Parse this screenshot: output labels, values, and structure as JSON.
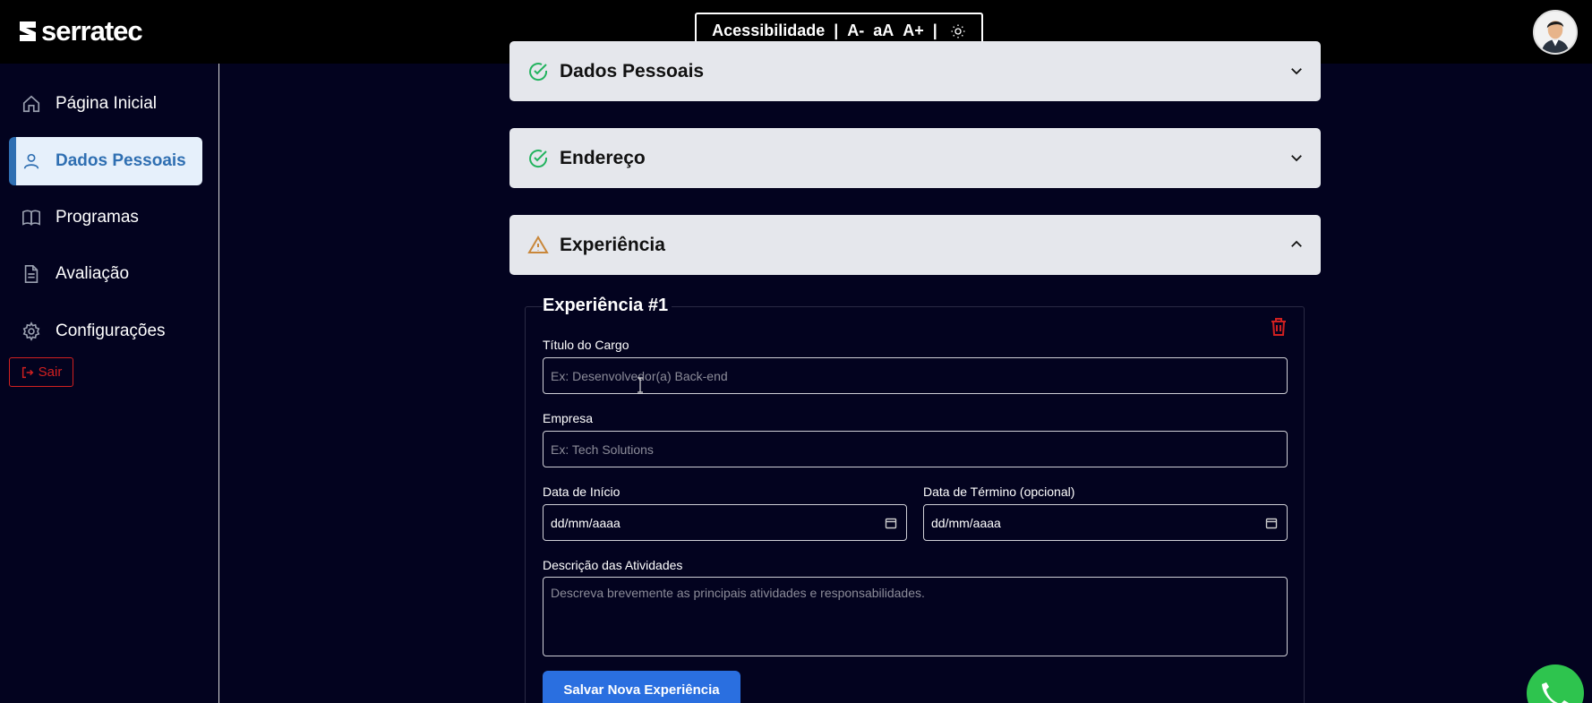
{
  "header": {
    "logo_text": "serratec",
    "accessibility": {
      "label": "Acessibilidade",
      "separator": "|",
      "decrease": "A-",
      "reset": "aA",
      "increase": "A+"
    }
  },
  "sidebar": {
    "items": [
      {
        "label": "Página Inicial",
        "icon": "home-icon"
      },
      {
        "label": "Dados Pessoais",
        "icon": "user-icon",
        "active": true
      },
      {
        "label": "Programas",
        "icon": "book-icon"
      },
      {
        "label": "Avaliação",
        "icon": "document-icon"
      },
      {
        "label": "Configurações",
        "icon": "gear-icon"
      }
    ],
    "logout_label": "Sair"
  },
  "sections": [
    {
      "title": "Dados Pessoais",
      "status": "complete"
    },
    {
      "title": "Endereço",
      "status": "complete"
    },
    {
      "title": "Experiência",
      "status": "warning",
      "expanded": true
    }
  ],
  "experience": {
    "card_title": "Experiência #1",
    "job_title": {
      "label": "Título do Cargo",
      "placeholder": "Ex: Desenvolvedor(a) Back-end"
    },
    "company": {
      "label": "Empresa",
      "placeholder": "Ex: Tech Solutions"
    },
    "start_date": {
      "label": "Data de Início",
      "value": "dd/mm/aaaa"
    },
    "end_date": {
      "label": "Data de Término (opcional)",
      "value": "dd/mm/aaaa"
    },
    "description": {
      "label": "Descrição das Atividades",
      "placeholder": "Descreva brevemente as principais atividades e responsabilidades."
    },
    "save_label": "Salvar Nova Experiência"
  },
  "colors": {
    "background": "#03031f",
    "accent": "#2a6fe0",
    "success": "#22b35e",
    "warning": "#c9873a",
    "danger": "#d12020",
    "active_nav": "#2f6fb2"
  }
}
